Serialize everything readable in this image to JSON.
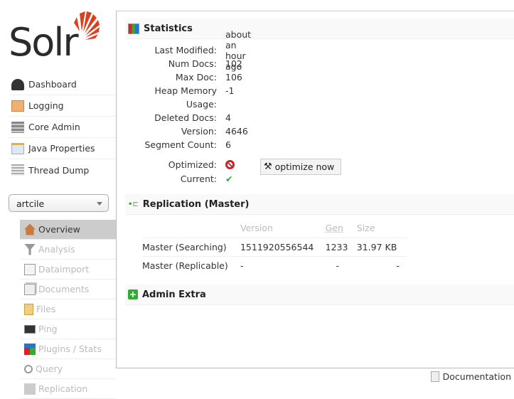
{
  "logo": {
    "text": "Solr"
  },
  "nav": [
    {
      "label": "Dashboard",
      "icon": "dashboard-icon"
    },
    {
      "label": "Logging",
      "icon": "logging-icon"
    },
    {
      "label": "Core Admin",
      "icon": "core-admin-icon"
    },
    {
      "label": "Java Properties",
      "icon": "java-properties-icon"
    },
    {
      "label": "Thread Dump",
      "icon": "thread-dump-icon"
    }
  ],
  "core_selector": {
    "value": "artcile"
  },
  "core_menu": [
    {
      "label": "Overview",
      "icon": "home-icon"
    },
    {
      "label": "Analysis",
      "icon": "funnel-icon"
    },
    {
      "label": "Dataimport",
      "icon": "dataimport-icon"
    },
    {
      "label": "Documents",
      "icon": "documents-icon"
    },
    {
      "label": "Files",
      "icon": "folder-icon"
    },
    {
      "label": "Ping",
      "icon": "ping-icon"
    },
    {
      "label": "Plugins / Stats",
      "icon": "plugins-icon"
    },
    {
      "label": "Query",
      "icon": "query-icon"
    },
    {
      "label": "Replication",
      "icon": "replication-icon"
    }
  ],
  "statistics": {
    "title": "Statistics",
    "rows": [
      {
        "label": "Last Modified:",
        "value": "about an hour ago"
      },
      {
        "label": "Num Docs:",
        "value": "102"
      },
      {
        "label": "Max Doc:",
        "value": "106"
      },
      {
        "label": "Heap Memory",
        "value": "-1"
      },
      {
        "label": "Usage:",
        "value": ""
      },
      {
        "label": "Deleted Docs:",
        "value": "4"
      },
      {
        "label": "Version:",
        "value": "4646"
      },
      {
        "label": "Segment Count:",
        "value": "6"
      }
    ],
    "optimized_label": "Optimized:",
    "current_label": "Current:",
    "optimize_button": "optimize now"
  },
  "replication": {
    "title": "Replication (Master)",
    "headers": [
      "",
      "Version",
      "Gen",
      "Size"
    ],
    "rows": [
      [
        "Master (Searching)",
        "1511920556544",
        "1233",
        "31.97 KB"
      ],
      [
        "Master (Replicable)",
        "-",
        "-",
        "-"
      ]
    ]
  },
  "admin_extra": {
    "title": "Admin Extra"
  },
  "footer": {
    "documentation": "Documentation"
  },
  "colors": {
    "accent": "#d9411e",
    "selected": "#cccccc"
  }
}
